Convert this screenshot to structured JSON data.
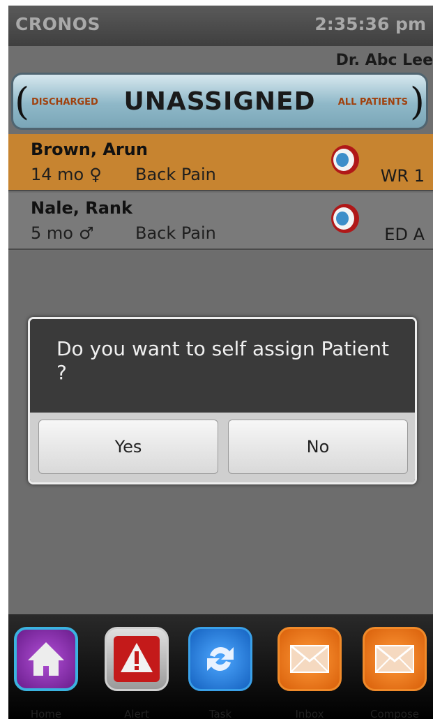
{
  "titlebar": {
    "app_name": "CRONOS",
    "time": "2:35:36 pm"
  },
  "doctor_name": "Dr. Abc Lee",
  "selector": {
    "left_option": "DISCHARGED",
    "current": "UNASSIGNED",
    "right_option": "ALL PATIENTS"
  },
  "patients": [
    {
      "name": "Brown, Arun",
      "age": "14 mo",
      "gender_symbol": "♀",
      "complaint": "Back Pain",
      "location": "WR 1"
    },
    {
      "name": "Nale, Rank",
      "age": "5 mo",
      "gender_symbol": "♂",
      "complaint": "Back Pain",
      "location": "ED A"
    }
  ],
  "dialog": {
    "message": "Do you want to self assign Patient ?",
    "yes_label": "Yes",
    "no_label": "No"
  },
  "dock": [
    {
      "label": "Home",
      "icon": "home-icon"
    },
    {
      "label": "Alert",
      "icon": "alert-icon"
    },
    {
      "label": "Task",
      "icon": "refresh-icon"
    },
    {
      "label": "Inbox",
      "icon": "envelope-icon"
    },
    {
      "label": "Compose",
      "icon": "envelope-icon"
    }
  ],
  "colors": {
    "row_highlight": "#c78430",
    "accent_text": "#a0410e",
    "selector_blue": "#8fb8c8"
  }
}
